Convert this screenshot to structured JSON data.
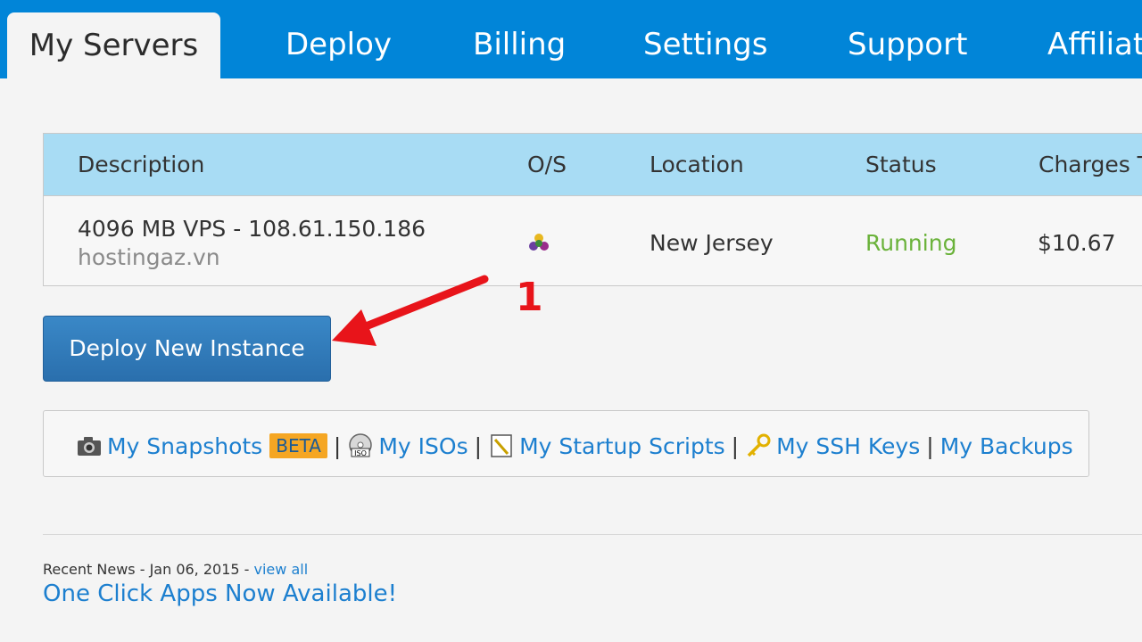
{
  "nav": {
    "tabs": [
      {
        "label": "My Servers",
        "active": true
      },
      {
        "label": "Deploy"
      },
      {
        "label": "Billing"
      },
      {
        "label": "Settings"
      },
      {
        "label": "Support"
      },
      {
        "label": "Affiliate"
      }
    ]
  },
  "servers": {
    "columns": [
      "Description",
      "O/S",
      "Location",
      "Status",
      "Charges T"
    ],
    "rows": [
      {
        "description": "4096 MB VPS - 108.61.150.186",
        "label": "hostingaz.vn",
        "os_icon": "os-logo-icon",
        "location": "New Jersey",
        "status": "Running",
        "charges": "$10.67"
      }
    ]
  },
  "actions": {
    "deploy_label": "Deploy New Instance"
  },
  "annotation": {
    "number": "1",
    "color": "#e8141a"
  },
  "links": {
    "snapshots": "My Snapshots",
    "beta": "BETA",
    "isos": "My ISOs",
    "startup_scripts": "My Startup Scripts",
    "ssh_keys": "My SSH Keys",
    "backups": "My Backups",
    "separator": "|"
  },
  "news": {
    "meta": "Recent News - Jan 06, 2015 -",
    "view_all": "view all",
    "title": "One Click Apps Now Available!"
  },
  "colors": {
    "nav_bg": "#0185d8",
    "link": "#1c7fcf",
    "status_running": "#6ab23a",
    "table_header": "#a8dcf4"
  }
}
